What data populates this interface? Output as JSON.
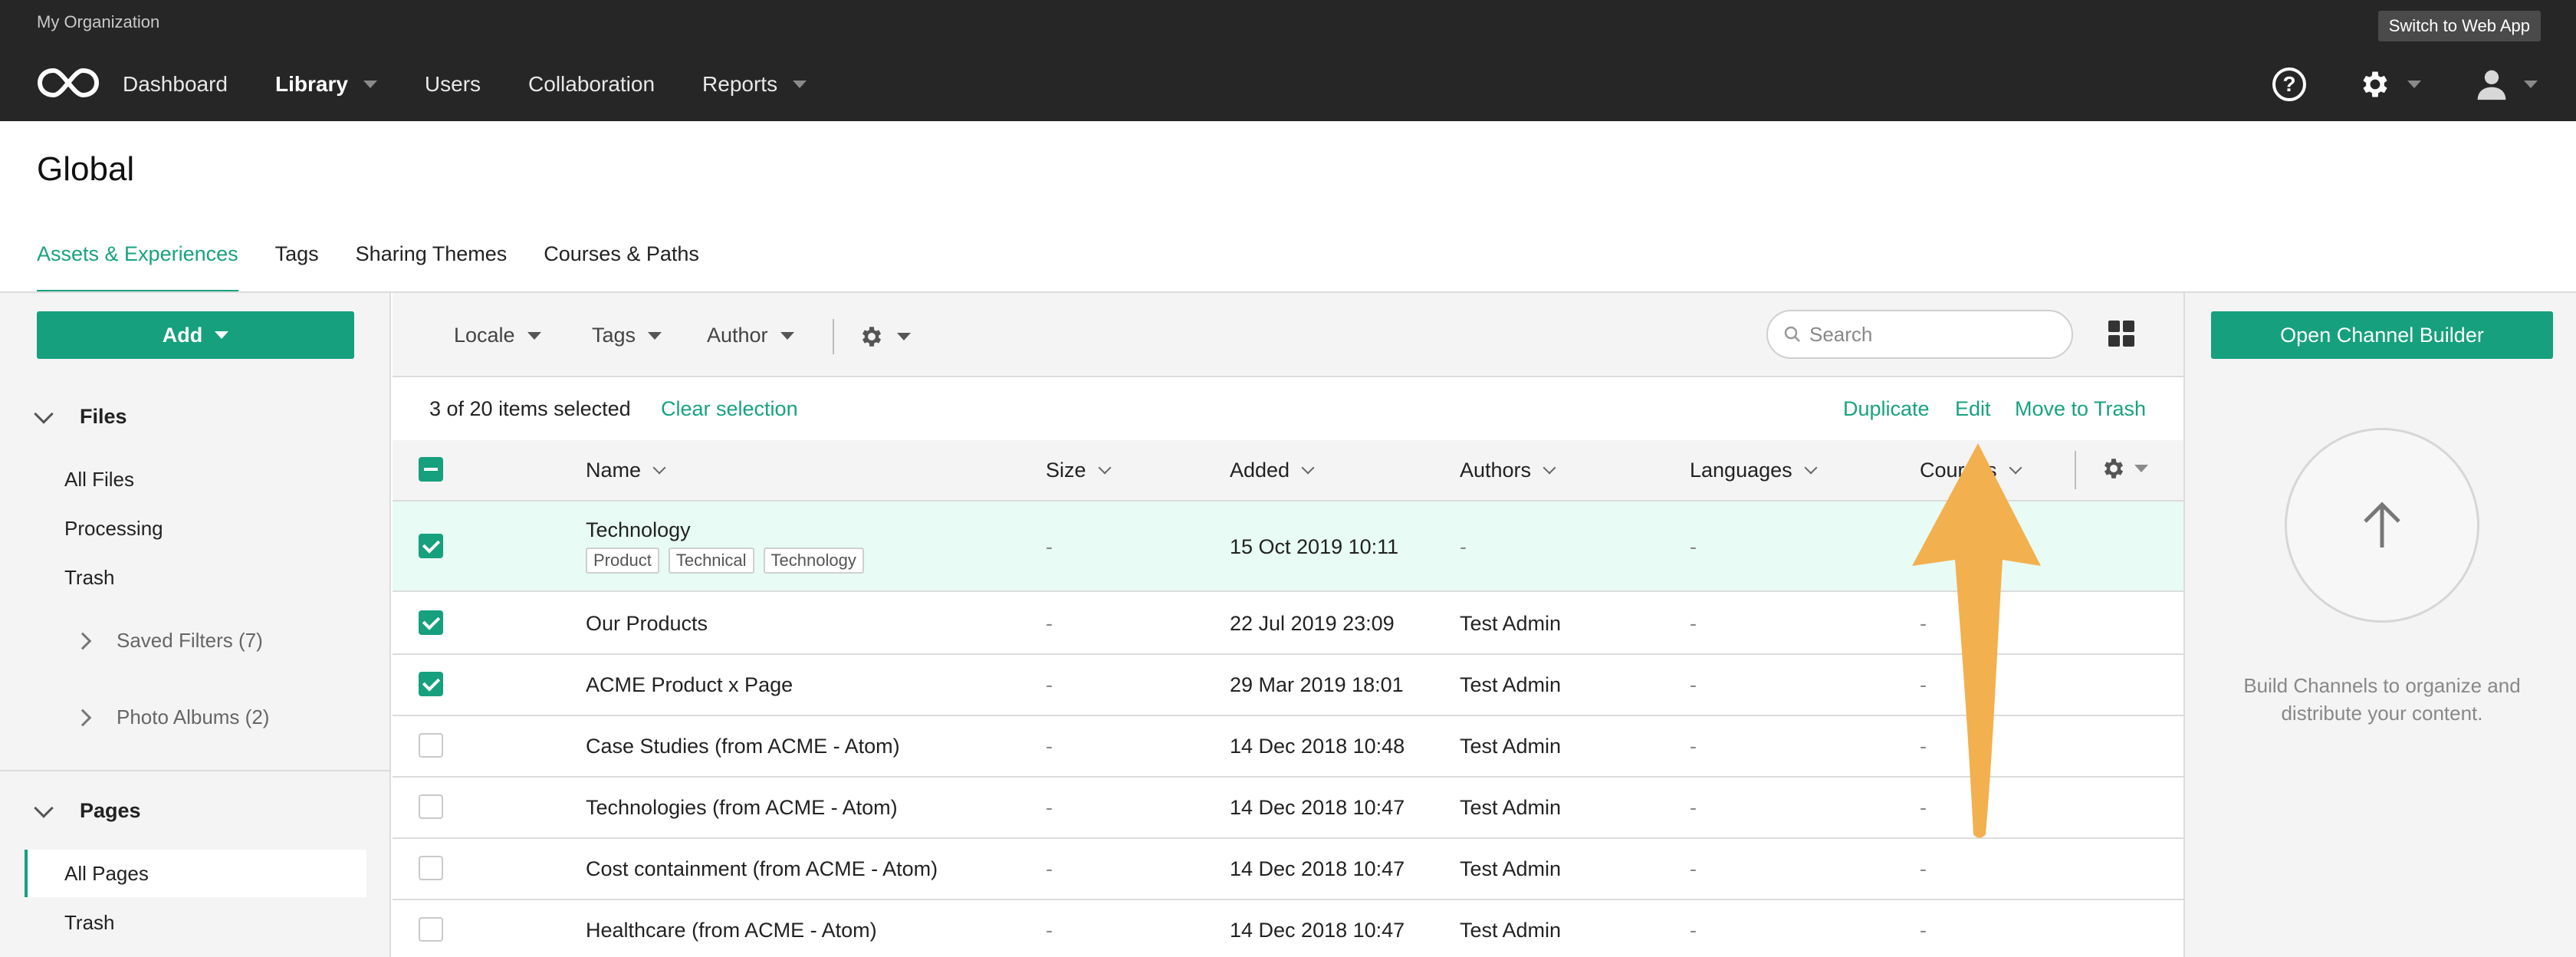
{
  "topbar": {
    "org_name": "My Organization",
    "switch_label": "Switch to Web App",
    "nav": [
      {
        "label": "Dashboard",
        "active": false,
        "dropdown": false
      },
      {
        "label": "Library",
        "active": true,
        "dropdown": true
      },
      {
        "label": "Users",
        "active": false,
        "dropdown": false
      },
      {
        "label": "Collaboration",
        "active": false,
        "dropdown": false
      },
      {
        "label": "Reports",
        "active": false,
        "dropdown": true
      }
    ],
    "help_glyph": "?",
    "icons": [
      "infinity-logo-icon",
      "help-icon",
      "gear-icon",
      "user-icon"
    ]
  },
  "page": {
    "title": "Global",
    "tabs": [
      "Assets & Experiences",
      "Tags",
      "Sharing Themes",
      "Courses & Paths"
    ],
    "active_tab": 0
  },
  "sidebar": {
    "add_label": "Add",
    "files_heading": "Files",
    "files_items": [
      "All Files",
      "Processing",
      "Trash"
    ],
    "saved_filters": "Saved Filters (7)",
    "photo_albums": "Photo Albums (2)",
    "pages_heading": "Pages",
    "pages_items": [
      "All Pages",
      "Trash"
    ],
    "active_page_item": "All Pages"
  },
  "toolbar": {
    "filters": [
      "Locale",
      "Tags",
      "Author"
    ],
    "search_placeholder": "Search"
  },
  "selection": {
    "count_text": "3 of 20 items selected",
    "clear_label": "Clear selection",
    "actions": [
      "Duplicate",
      "Edit",
      "Move to Trash"
    ]
  },
  "table": {
    "columns": [
      "Name",
      "Size",
      "Added",
      "Authors",
      "Languages",
      "Courses"
    ],
    "rows": [
      {
        "name": "Technology",
        "tags": [
          "Product",
          "Technical",
          "Technology"
        ],
        "size": "-",
        "added": "15 Oct 2019 10:11",
        "authors": "-",
        "languages": "-",
        "courses": "",
        "checked": true,
        "highlight": true
      },
      {
        "name": "Our Products",
        "tags": [],
        "size": "-",
        "added": "22 Jul 2019 23:09",
        "authors": "Test Admin",
        "languages": "-",
        "courses": "-",
        "checked": true,
        "highlight": false
      },
      {
        "name": "ACME Product x Page",
        "tags": [],
        "size": "-",
        "added": "29 Mar 2019 18:01",
        "authors": "Test Admin",
        "languages": "-",
        "courses": "-",
        "checked": true,
        "highlight": false
      },
      {
        "name": "Case Studies (from ACME - Atom)",
        "tags": [],
        "size": "-",
        "added": "14 Dec 2018 10:48",
        "authors": "Test Admin",
        "languages": "-",
        "courses": "-",
        "checked": false,
        "highlight": false
      },
      {
        "name": "Technologies (from ACME - Atom)",
        "tags": [],
        "size": "-",
        "added": "14 Dec 2018 10:47",
        "authors": "Test Admin",
        "languages": "-",
        "courses": "-",
        "checked": false,
        "highlight": false
      },
      {
        "name": "Cost containment (from ACME - Atom)",
        "tags": [],
        "size": "-",
        "added": "14 Dec 2018 10:47",
        "authors": "Test Admin",
        "languages": "-",
        "courses": "-",
        "checked": false,
        "highlight": false
      },
      {
        "name": "Healthcare (from ACME - Atom)",
        "tags": [],
        "size": "-",
        "added": "14 Dec 2018 10:47",
        "authors": "Test Admin",
        "languages": "-",
        "courses": "-",
        "checked": false,
        "highlight": false
      }
    ]
  },
  "right_panel": {
    "button_label": "Open Channel Builder",
    "text": "Build Channels to organize and distribute your content."
  },
  "colors": {
    "accent": "#16a07d",
    "topbar": "#262626",
    "row_highlight": "#e8fbf5",
    "annotation_arrow": "#f2b04e"
  }
}
